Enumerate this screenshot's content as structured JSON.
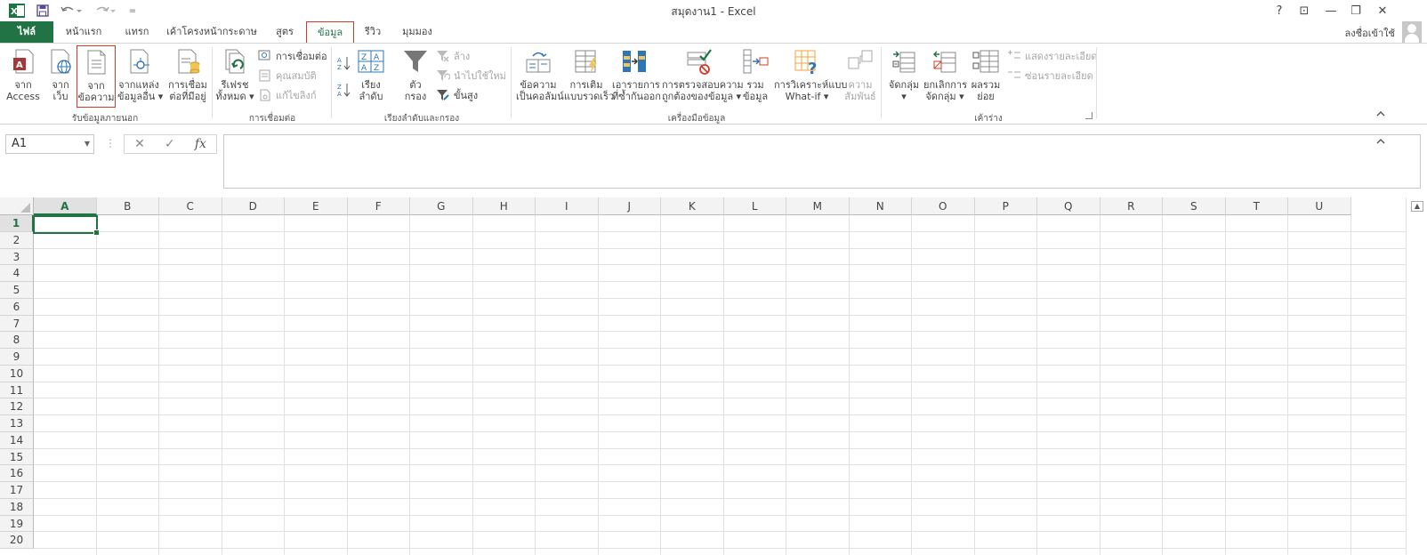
{
  "window": {
    "title": "สมุดงาน1 - Excel",
    "help": "?",
    "ribbon_display": "⊡",
    "minimize": "—",
    "restore": "❐",
    "close": "✕"
  },
  "quick_access": {
    "excel_logo": "X",
    "customize": "="
  },
  "tabs": [
    {
      "label": "ไฟล์"
    },
    {
      "label": "หน้าแรก"
    },
    {
      "label": "แทรก"
    },
    {
      "label": "เค้าโครงหน้ากระดาษ"
    },
    {
      "label": "สูตร"
    },
    {
      "label": "ข้อมูล"
    },
    {
      "label": "รีวิว"
    },
    {
      "label": "มุมมอง"
    }
  ],
  "account": {
    "signin": "ลงชื่อเข้าใช้"
  },
  "ribbon": {
    "groups": [
      {
        "label": "รับข้อมูลภายนอก"
      },
      {
        "label": "การเชื่อมต่อ"
      },
      {
        "label": "เรียงลำดับและกรอง"
      },
      {
        "label": "เครื่องมือข้อมูล"
      },
      {
        "label": "เค้าร่าง"
      }
    ],
    "buttons": {
      "from_access": [
        "จาก",
        "Access"
      ],
      "from_web": [
        "จาก",
        "เว็บ"
      ],
      "from_text": [
        "จาก",
        "ข้อความ"
      ],
      "from_other": [
        "จากแหล่ง",
        "ข้อมูลอื่น ▾"
      ],
      "existing_conn": [
        "การเชื่อม",
        "ต่อที่มีอยู่"
      ],
      "refresh_all": [
        "รีเฟรช",
        "ทั้งหมด ▾"
      ],
      "connections": "การเชื่อมต่อ",
      "properties": "คุณสมบัติ",
      "edit_links": "แก้ไขลิงก์",
      "sort": [
        "เรียง",
        "ลำดับ"
      ],
      "filter": [
        "ตัว",
        "กรอง"
      ],
      "clear": "ล้าง",
      "reapply": "นำไปใช้ใหม่",
      "advanced": "ขั้นสูง",
      "text_to_columns": [
        "ข้อความ",
        "เป็นคอลัมน์"
      ],
      "flash_fill": [
        "การเติม",
        "แบบรวดเร็ว"
      ],
      "remove_duplicates": [
        "เอารายการ",
        "ที่ซ้ำกันออก"
      ],
      "data_validation": [
        "การตรวจสอบความ",
        "ถูกต้องของข้อมูล ▾"
      ],
      "consolidate": [
        "รวม",
        "ข้อมูล"
      ],
      "what_if": [
        "การวิเคราะห์แบบ",
        "What-if ▾"
      ],
      "relationships": [
        "ความ",
        "สัมพันธ์"
      ],
      "group": [
        "จัดกลุ่ม",
        "▾"
      ],
      "ungroup": [
        "ยกเลิกการ",
        "จัดกลุ่ม ▾"
      ],
      "subtotal": [
        "ผลรวม",
        "ย่อย"
      ],
      "show_detail": "แสดงรายละเอียด",
      "hide_detail": "ซ่อนรายละเอียด"
    }
  },
  "formula_bar": {
    "name_box": "A1",
    "cancel": "✕",
    "enter": "✓",
    "fx": "fx",
    "value": ""
  },
  "sheet": {
    "columns": [
      "A",
      "B",
      "C",
      "D",
      "E",
      "F",
      "G",
      "H",
      "I",
      "J",
      "K",
      "L",
      "M",
      "N",
      "O",
      "P",
      "Q",
      "R",
      "S",
      "T",
      "U"
    ],
    "rows": [
      "1",
      "2",
      "3",
      "4",
      "5",
      "6",
      "7",
      "8",
      "9",
      "10",
      "11",
      "12",
      "13",
      "14",
      "15",
      "16",
      "17",
      "18",
      "19",
      "20"
    ],
    "active_cell": "A1"
  },
  "colors": {
    "accent": "#217346",
    "highlight": "#d13c26"
  }
}
